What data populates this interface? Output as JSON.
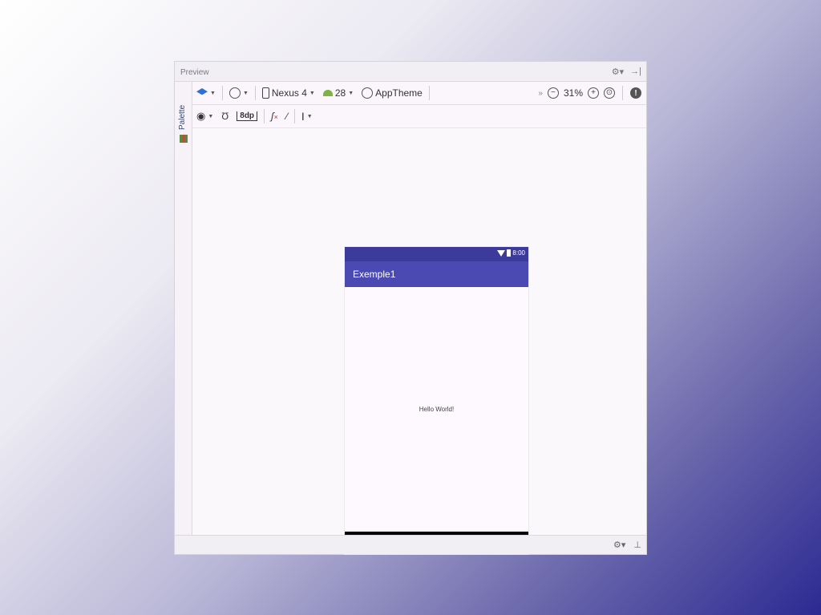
{
  "window": {
    "title": "Preview",
    "gear_glyph": "⚙▾",
    "hide_glyph": "→|"
  },
  "palette": {
    "label": "Palette"
  },
  "toolbar": {
    "device": "Nexus 4",
    "api_level": "28",
    "theme": "AppTheme",
    "zoom": "31%",
    "collapse_glyph": "»",
    "margin": "8dp",
    "zoom_out_glyph": "−",
    "zoom_in_glyph": "+",
    "zoom_fit_glyph": "⊙",
    "info_glyph": "!"
  },
  "icons": {
    "design_surface": "layers-icon",
    "orientation": "rotate-icon",
    "device": "phone-icon",
    "api": "android-icon",
    "theme": "theme-icon",
    "visibility": "eye-icon",
    "autoconnect": "magnet-icon",
    "clear_constraints": "clear-constraints-icon",
    "infer_constraints": "magic-wand-icon",
    "guidelines": "guideline-icon"
  },
  "phone": {
    "time": "8:00",
    "app_title": "Exemple1",
    "hello": "Hello World!",
    "colors": {
      "status_bar": "#3c3a9a",
      "app_bar": "#4a4ab2",
      "nav_bar": "#050505"
    }
  },
  "bottom": {
    "gear_glyph": "⚙▾",
    "hide_glyph": "⊥"
  }
}
